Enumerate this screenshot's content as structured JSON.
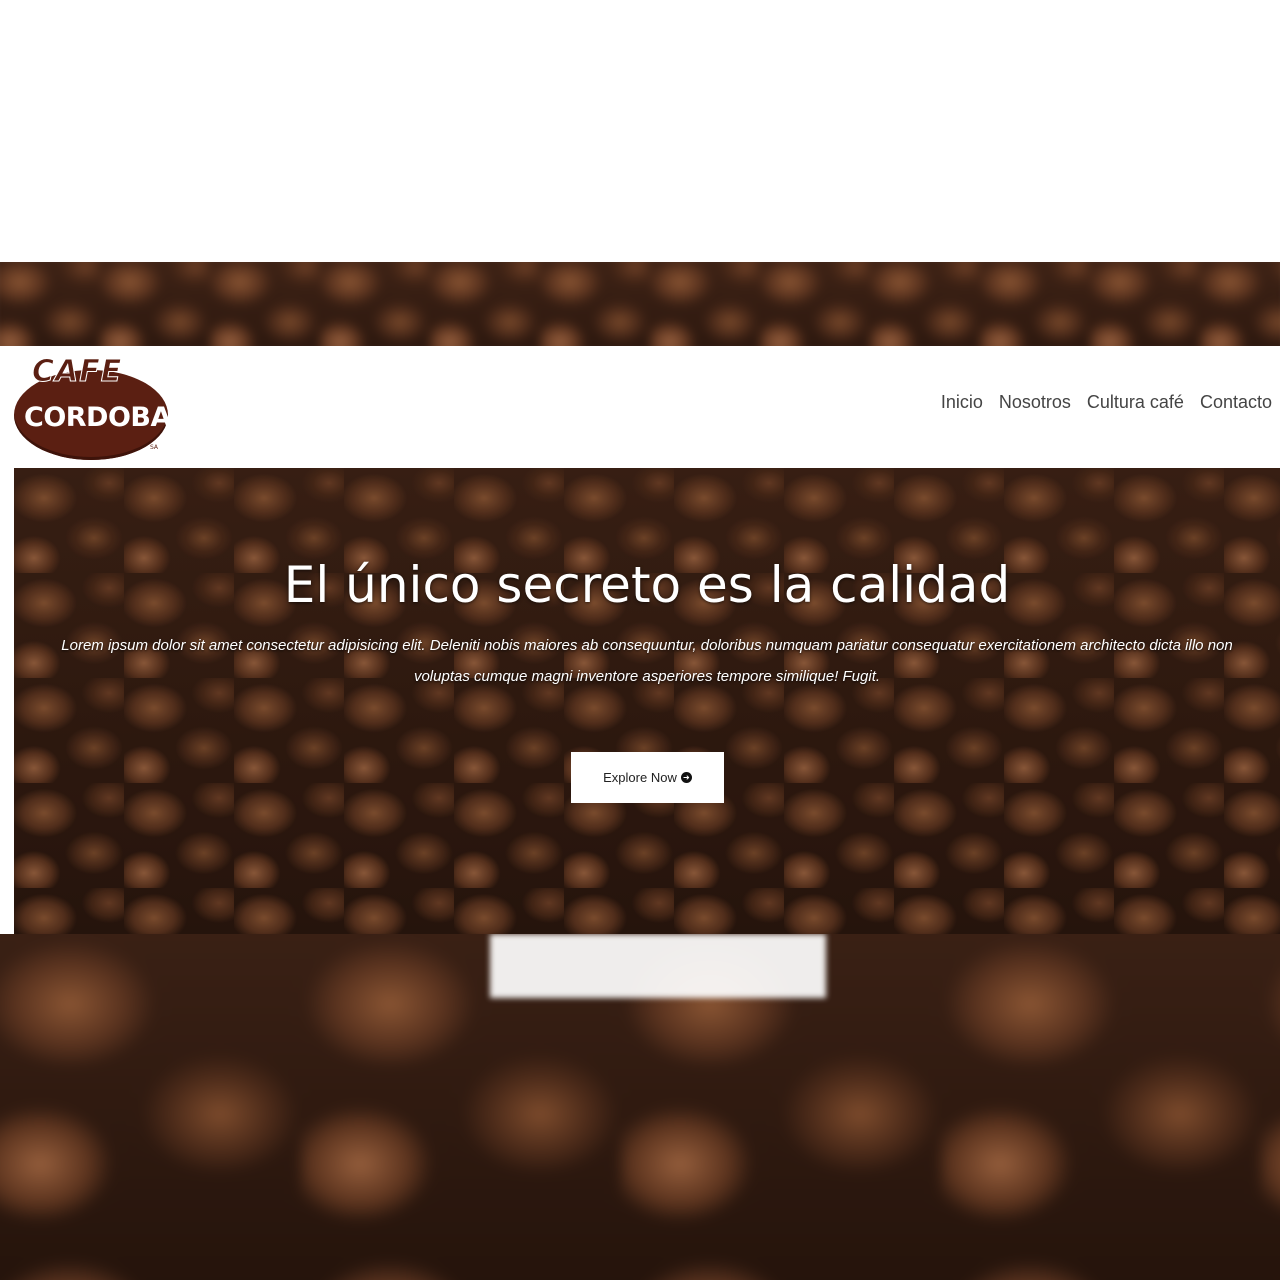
{
  "logo": {
    "line1": "CAFE",
    "line2": "CORDOBA",
    "mark": "SA"
  },
  "nav": {
    "items": [
      "Inicio",
      "Nosotros",
      "Cultura café",
      "Contacto"
    ]
  },
  "hero": {
    "title": "El único secreto es la calidad",
    "text": "Lorem ipsum dolor sit amet consectetur adipisicing elit. Deleniti nobis maiores ab consequuntur, doloribus numquam pariatur consequatur exercitationem architecto dicta illo non voluptas cumque magni inventore asperiores tempore similique! Fugit.",
    "button_label": "Explore Now",
    "button_icon": "arrow-right-circle-icon"
  },
  "colors": {
    "brand": "#5b1f12",
    "nav_text": "#444444",
    "hero_text": "#ffffff"
  }
}
